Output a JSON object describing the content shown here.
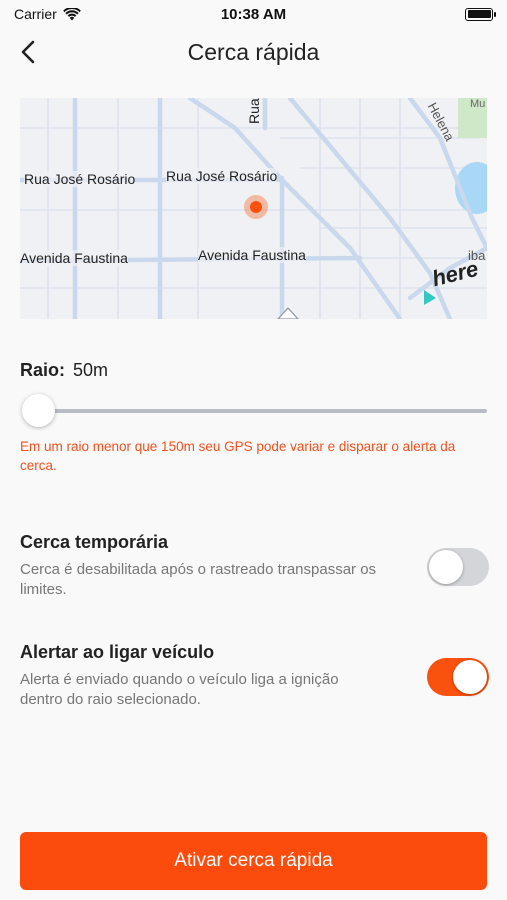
{
  "status_bar": {
    "carrier": "Carrier",
    "time": "10:38 AM"
  },
  "nav": {
    "title": "Cerca rápida"
  },
  "map": {
    "labels": {
      "rua_jose_rosario_1": "Rua José Rosário",
      "rua_jose_rosario_2": "Rua José Rosário",
      "avenida_faustina_1": "Avenida Faustina",
      "avenida_faustina_2": "Avenida Faustina",
      "rua_top": "Rua",
      "helena": "Helena",
      "mu": "Mu",
      "iba": "iba",
      "here_logo": "here"
    },
    "colors": {
      "road": "#c9d8ec",
      "water": "#a9d7f6",
      "park": "#cfe9c8",
      "pin": "#f9510e"
    }
  },
  "radius": {
    "label": "Raio:",
    "value": "50m",
    "level": 0
  },
  "warning": "Em um raio menor que 150m seu GPS pode variar e disparar o alerta da cerca.",
  "settings": [
    {
      "title": "Cerca temporária",
      "description": "Cerca é desabilitada após o rastreado transpassar os limites.",
      "enabled": false
    },
    {
      "title": "Alertar ao ligar veículo",
      "description": "Alerta é enviado quando o veículo liga a ignição dentro do raio selecionado.",
      "enabled": true
    }
  ],
  "cta": {
    "label": "Ativar cerca rápida"
  },
  "colors": {
    "accent": "#fc4c0d",
    "warning": "#f0511d",
    "toggle_off": "#d4d5d8"
  }
}
